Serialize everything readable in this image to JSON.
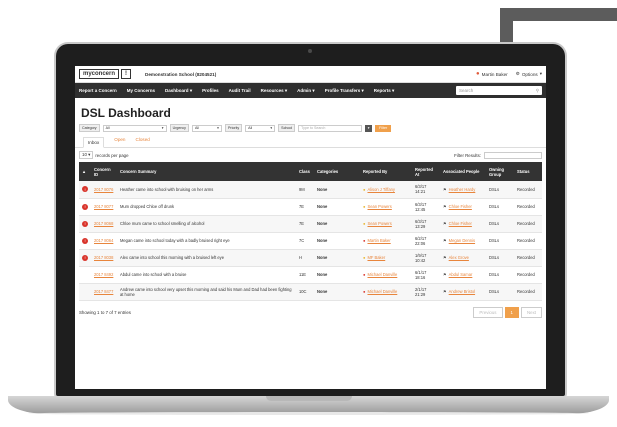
{
  "app": {
    "logo": "myconcern",
    "school": "Demonstration School (8204521)",
    "user": "Martin Baker",
    "options": "Options"
  },
  "nav": {
    "items": [
      "Report a Concern",
      "My Concerns",
      "Dashboard",
      "Profiles",
      "Audit Trail",
      "Resources",
      "Admin",
      "Profile Transfers",
      "Reports"
    ],
    "search_placeholder": "Search"
  },
  "page": {
    "title": "DSL Dashboard"
  },
  "filters": {
    "category_label": "Category",
    "category_value": "All",
    "urgency_label": "Urgency",
    "urgency_value": "All",
    "priority_label": "Priority",
    "priority_value": "All",
    "school_label": "School",
    "search_placeholder": "Type to Search",
    "filter_button": "Filter"
  },
  "tabs": [
    "Inbox",
    "Open",
    "Closed"
  ],
  "table": {
    "length_value": "10",
    "length_suffix": "records per page",
    "filter_label": "Filter Results:",
    "headers": [
      "",
      "Concern ID",
      "Concern Summary",
      "Class",
      "Categories",
      "Reported By",
      "Reported At",
      "Associated People",
      "Owning Group",
      "Status"
    ],
    "rows": [
      {
        "alert": true,
        "id": "2017 8076",
        "summary": "Heather came into school with bruising on her arms",
        "class": "9M",
        "cat": "None",
        "by": "Alison J Tiffany",
        "by_color": "yellow",
        "at": "6/3/17 14:21",
        "people": "Heather Hardy",
        "group": "DSLs",
        "status": "Recorded"
      },
      {
        "alert": true,
        "id": "2017 8077",
        "summary": "Mum dropped Chloe off drunk",
        "class": "7E",
        "cat": "None",
        "by": "Sean Powers",
        "by_color": "yellow",
        "at": "6/3/17 12:45",
        "people": "Chloe Fisher",
        "group": "DSLs",
        "status": "Recorded"
      },
      {
        "alert": true,
        "id": "2017 8068",
        "summary": "Chloe mum came to school smelling of alcohol",
        "class": "7E",
        "cat": "None",
        "by": "Sean Powers",
        "by_color": "yellow",
        "at": "6/3/17 13:29",
        "people": "Chloe Fisher",
        "group": "DSLs",
        "status": "Recorded"
      },
      {
        "alert": true,
        "id": "2017 8064",
        "summary": "Megan came into school today with a badly bruised right eye",
        "class": "7C",
        "cat": "None",
        "by": "Martin Baker",
        "by_color": "red",
        "at": "6/2/17 22:06",
        "people": "Megan Dennis",
        "group": "DSLs",
        "status": "Recorded"
      },
      {
        "alert": true,
        "id": "2017 8038",
        "summary": "Alex came into school this morning with a bruised left eye",
        "class": "H",
        "cat": "None",
        "by": "MF Baker",
        "by_color": "yellow",
        "at": "1/9/17 10:42",
        "people": "Alex Grove",
        "group": "DSLs",
        "status": "Recorded"
      },
      {
        "alert": false,
        "id": "2017 8492",
        "summary": "Abdul came into school with a bruise",
        "class": "11E",
        "cat": "None",
        "by": "Michael Danville",
        "by_color": "red",
        "at": "6/1/17 18:16",
        "people": "Abdul Samar",
        "group": "DSLs",
        "status": "Recorded"
      },
      {
        "alert": false,
        "id": "2017 8477",
        "summary": "Andrew came into school very upset this morning and said his Mum and Dad had been fighting at home",
        "class": "10C",
        "cat": "None",
        "by": "Michael Danville",
        "by_color": "red",
        "at": "2/1/17 21:29",
        "people": "Andrew Bristol",
        "group": "DSLs",
        "status": "Recorded"
      }
    ]
  },
  "footer": {
    "showing": "Showing 1 to 7 of 7 entries",
    "prev": "Previous",
    "page": "1",
    "next": "Next"
  }
}
